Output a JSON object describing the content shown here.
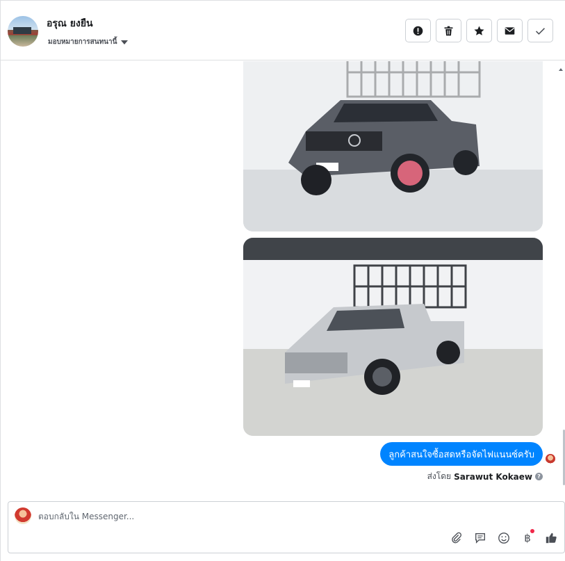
{
  "header": {
    "contact_name": "อรุณ ยงยืน",
    "assign_label": "มอบหมายการสนทนานี้",
    "actions": [
      "spam-icon",
      "trash-icon",
      "star-icon",
      "envelope-icon",
      "check-icon"
    ]
  },
  "thread": {
    "images": [
      {
        "icon": "photo-pickup-truck-1"
      },
      {
        "icon": "photo-pickup-truck-2"
      }
    ],
    "message_text": "ลูกค้าสนใจซื้อสดหรือจัดไฟแนนซ์ครับ",
    "sent_by_prefix": "ส่งโดย",
    "sent_by_name": "Sarawut Kokaew",
    "bubble_color": "#0084ff"
  },
  "composer": {
    "placeholder": "ตอบกลับใน Messenger...",
    "tools": [
      "paperclip-icon",
      "saved-reply-icon",
      "emoji-icon",
      "baht-icon",
      "like-icon"
    ],
    "baht_symbol": "฿"
  }
}
